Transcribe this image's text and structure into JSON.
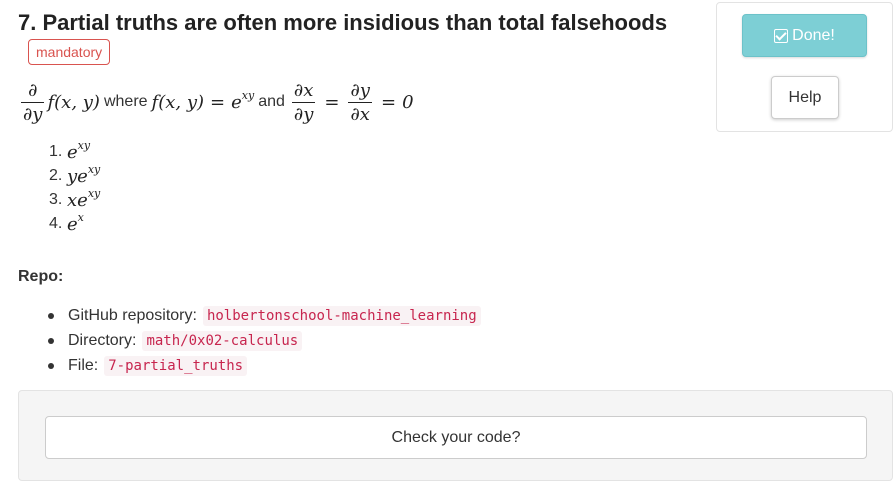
{
  "task": {
    "title": "7. Partial truths are often more insidious than total falsehoods",
    "badge": "mandatory"
  },
  "statement": {
    "partial_num": "∂",
    "partial_den": "∂y",
    "function": "f(x, y)",
    "where_word": "where",
    "def_lhs": "f(x, y)",
    "equals": "=",
    "def_base": "e",
    "def_exp": "xy",
    "and_word": "and",
    "frac1_num": "∂x",
    "frac1_den": "∂y",
    "frac2_num": "∂y",
    "frac2_den": "∂x",
    "zero": "0"
  },
  "options": [
    {
      "number": "1.",
      "prefix": "",
      "base": "e",
      "exp": "xy"
    },
    {
      "number": "2.",
      "prefix": "y",
      "base": "e",
      "exp": "xy"
    },
    {
      "number": "3.",
      "prefix": "x",
      "base": "e",
      "exp": "xy"
    },
    {
      "number": "4.",
      "prefix": "",
      "base": "e",
      "exp": "x"
    }
  ],
  "repo": {
    "heading": "Repo:",
    "items": [
      {
        "label": "GitHub repository:",
        "value": "holbertonschool-machine_learning"
      },
      {
        "label": "Directory:",
        "value": "math/0x02-calculus"
      },
      {
        "label": "File:",
        "value": "7-partial_truths"
      }
    ]
  },
  "side": {
    "done_label": "Done!",
    "help_label": "Help"
  },
  "check": {
    "button_label": "Check your code?"
  },
  "colors": {
    "done_bg": "#7dcfd5",
    "badge": "#d9534f",
    "code_text": "#c7254e",
    "code_bg": "#f9f2f4"
  }
}
